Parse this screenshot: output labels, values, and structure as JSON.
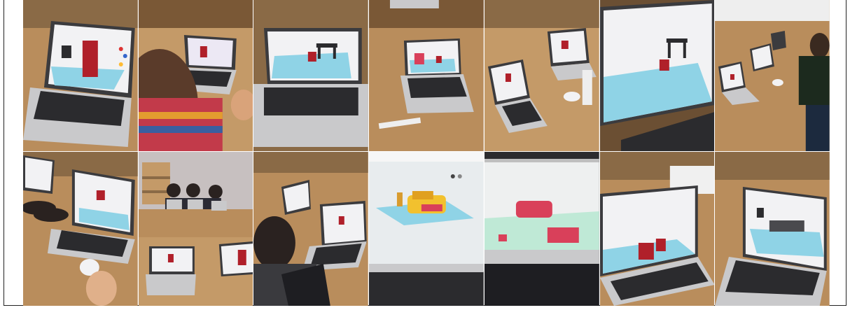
{
  "collage": {
    "rows": 2,
    "columns": 7,
    "photos": [
      {
        "subject": "laptop-3d-chair"
      },
      {
        "subject": "student-laptop"
      },
      {
        "subject": "laptop-3d-table-chair"
      },
      {
        "subject": "laptop-3d-chairs"
      },
      {
        "subject": "classroom-laptops"
      },
      {
        "subject": "laptop-3d-table-chair-closeup"
      },
      {
        "subject": "students-laptop-row"
      },
      {
        "subject": "hands-laptop-3d"
      },
      {
        "subject": "students-group-laptops"
      },
      {
        "subject": "student-back-laptop"
      },
      {
        "subject": "screen-3d-yellow-sofa"
      },
      {
        "subject": "screen-3d-pink-sofa"
      },
      {
        "subject": "laptop-3d-red-chairs"
      },
      {
        "subject": "laptop-3d-bed"
      }
    ]
  },
  "colors": {
    "wood": "#b98d5c",
    "wood_dark": "#7a5836",
    "laptop_silver": "#c9c9cb",
    "keyboard": "#2b2b2e",
    "screen_white": "#f2f2f4",
    "workplane": "#8fd3e6",
    "model_red": "#b0202a",
    "model_yellow": "#f2c12e",
    "model_pink": "#d9405a"
  }
}
